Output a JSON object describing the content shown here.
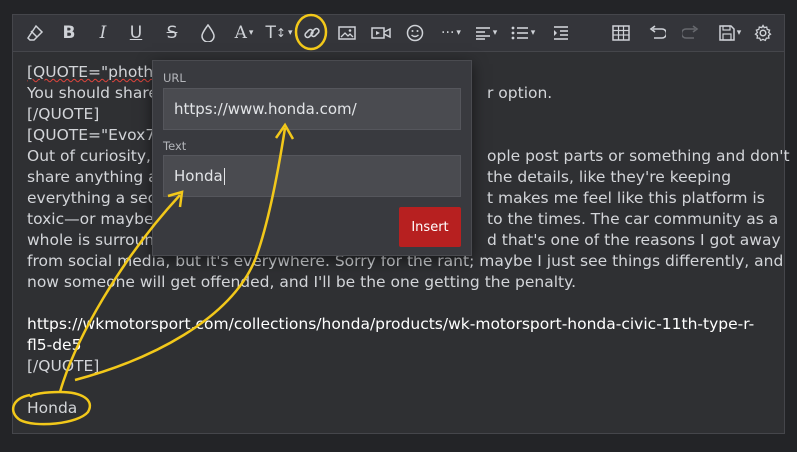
{
  "editor_content": {
    "lines": [
      "[QUOTE=\"phothro",
      "You should share",
      "[/QUOTE]",
      "[QUOTE=\"Evox787",
      "Out of curiosity, I",
      "share anything a",
      "everything a sec",
      "toxic—or maybe",
      "whole is surround",
      "from social media, but it's everywhere. Sorry for the rant; maybe I just see things differently, and",
      "now someone will get offended, and I'll be the one getting the penalty.",
      "",
      "https://wkmotorsport.com/collections/honda/products/wk-motorsport-honda-civic-11th-type-r-",
      "fl5-de5",
      "[/QUOTE]",
      "",
      "Honda"
    ],
    "right_fragments": [
      {
        "line": 1,
        "text": "r option."
      },
      {
        "line": 4,
        "text": "ople post parts or something and don't"
      },
      {
        "line": 5,
        "text": "the details, like they're keeping"
      },
      {
        "line": 6,
        "text": "t makes me feel like this platform is"
      },
      {
        "line": 7,
        "text": "to the times. The car community as a"
      },
      {
        "line": 8,
        "text": "d that's one of the reasons I got away"
      }
    ]
  },
  "link_dialog": {
    "url_label": "URL",
    "url_value": "https://www.honda.com/",
    "text_label": "Text",
    "text_value": "Honda",
    "insert_label": "Insert"
  },
  "toolbar": {
    "items": [
      "eraser-icon",
      "bold-icon",
      "italic-icon",
      "underline-icon",
      "strike-icon",
      "color-icon",
      "font-family-icon",
      "font-size-icon",
      "link-icon",
      "image-icon",
      "media-icon",
      "emoji-icon",
      "more-icon",
      "align-icon",
      "list-icon",
      "indent-icon",
      "table-icon",
      "undo-icon",
      "redo-icon",
      "save-draft-icon",
      "settings-icon"
    ]
  },
  "colors": {
    "background": "#2f3033",
    "toolbar": "#34353a",
    "insert_button": "#b72020",
    "annotation": "#f2c81a"
  }
}
